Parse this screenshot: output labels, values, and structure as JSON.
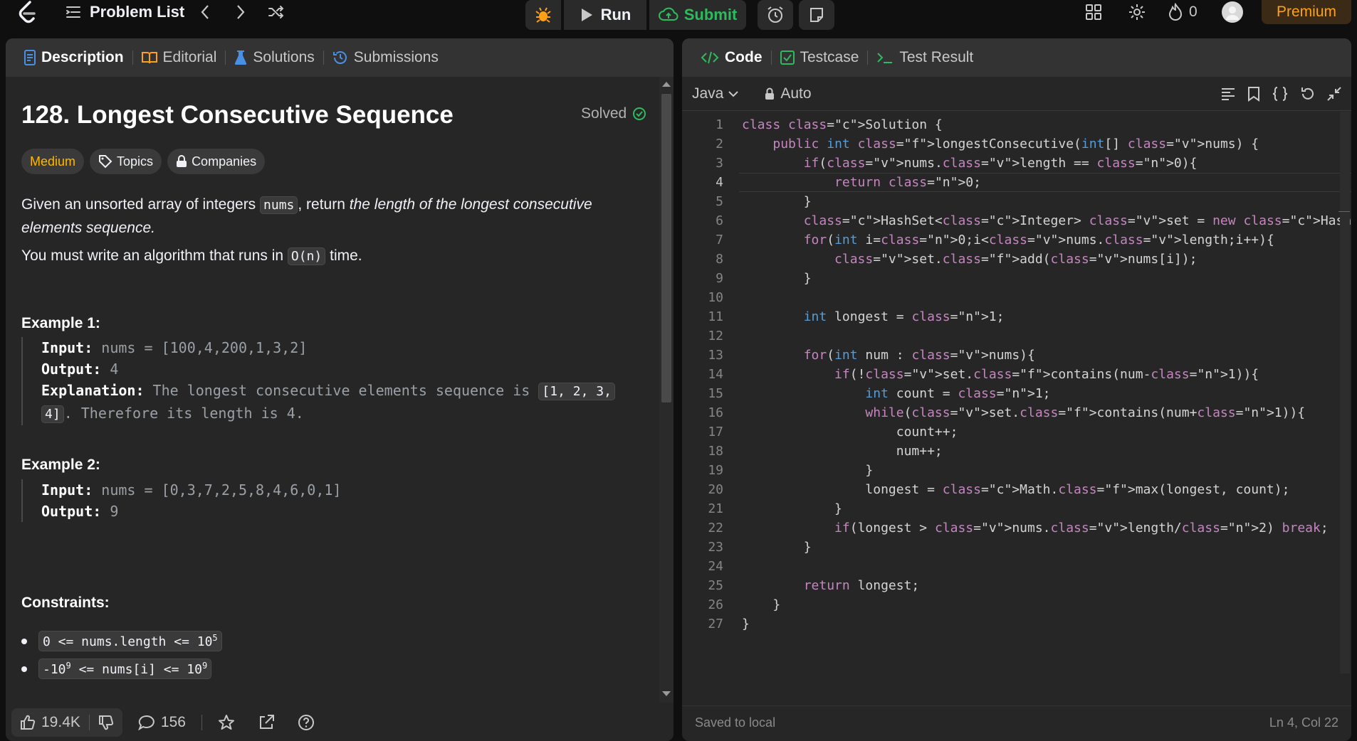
{
  "topbar": {
    "problem_list_label": "Problem List",
    "run_label": "Run",
    "submit_label": "Submit",
    "streak_count": "0",
    "premium_label": "Premium"
  },
  "left_tabs": [
    {
      "label": "Description",
      "icon": "document-icon"
    },
    {
      "label": "Editorial",
      "icon": "book-icon"
    },
    {
      "label": "Solutions",
      "icon": "flask-icon"
    },
    {
      "label": "Submissions",
      "icon": "history-icon"
    }
  ],
  "problem": {
    "title": "128. Longest Consecutive Sequence",
    "status": "Solved",
    "difficulty": "Medium",
    "topics_label": "Topics",
    "companies_label": "Companies",
    "desc_p1_a": "Given an unsorted array of integers ",
    "desc_p1_code": "nums",
    "desc_p1_b": ", return ",
    "desc_p1_em": "the length of the longest consecutive elements sequence.",
    "desc_p2_a": "You must write an algorithm that runs in ",
    "desc_p2_code": "O(n)",
    "desc_p2_b": " time.",
    "example1_heading": "Example 1:",
    "example1": {
      "input_label": "Input:",
      "input_value": " nums = [100,4,200,1,3,2]",
      "output_label": "Output:",
      "output_value": " 4",
      "explanation_label": "Explanation:",
      "explanation_a": " The longest consecutive elements sequence is ",
      "explanation_code_1": "[1, 2, 3,",
      "explanation_code_2": "4]",
      "explanation_b": ". Therefore its length is 4."
    },
    "example2_heading": "Example 2:",
    "example2": {
      "input_label": "Input:",
      "input_value": " nums = [0,3,7,2,5,8,4,6,0,1]",
      "output_label": "Output:",
      "output_value": " 9"
    },
    "constraints_heading": "Constraints:",
    "constraint1": {
      "text": "0 <= nums.length <= 10",
      "sup": "5"
    },
    "constraint2": {
      "pre": "-10",
      "pre_sup": "9",
      "text": " <= nums[i] <= 10",
      "sup": "9"
    }
  },
  "bottom": {
    "likes": "19.4K",
    "comments": "156"
  },
  "right_tabs": [
    {
      "label": "Code",
      "icon": "code-icon"
    },
    {
      "label": "Testcase",
      "icon": "checkbox-icon"
    },
    {
      "label": "Test Result",
      "icon": "terminal-icon"
    }
  ],
  "editor": {
    "language": "Java",
    "mode": "Auto",
    "status_left": "Saved to local",
    "status_right": "Ln 4, Col 22",
    "current_line": 4,
    "line_numbers": [
      "1",
      "2",
      "3",
      "4",
      "5",
      "6",
      "7",
      "8",
      "9",
      "10",
      "11",
      "12",
      "13",
      "14",
      "15",
      "16",
      "17",
      "18",
      "19",
      "20",
      "21",
      "22",
      "23",
      "24",
      "25",
      "26",
      "27"
    ],
    "lines": [
      "class Solution {",
      "    public int longestConsecutive(int[] nums) {",
      "        if(nums.length == 0){",
      "            return 0;",
      "        }",
      "        HashSet<Integer> set = new HashSet<>();",
      "        for(int i=0;i<nums.length;i++){",
      "            set.add(nums[i]);",
      "        }",
      "",
      "        int longest = 1;",
      "",
      "        for(int num : nums){",
      "            if(!set.contains(num-1)){",
      "                int count = 1;",
      "                while(set.contains(num+1)){",
      "                    count++;",
      "                    num++;",
      "                }",
      "                longest = Math.max(longest, count);",
      "            }",
      "            if(longest > nums.length/2) break;",
      "        }",
      "",
      "        return longest;",
      "    }",
      "}"
    ]
  }
}
